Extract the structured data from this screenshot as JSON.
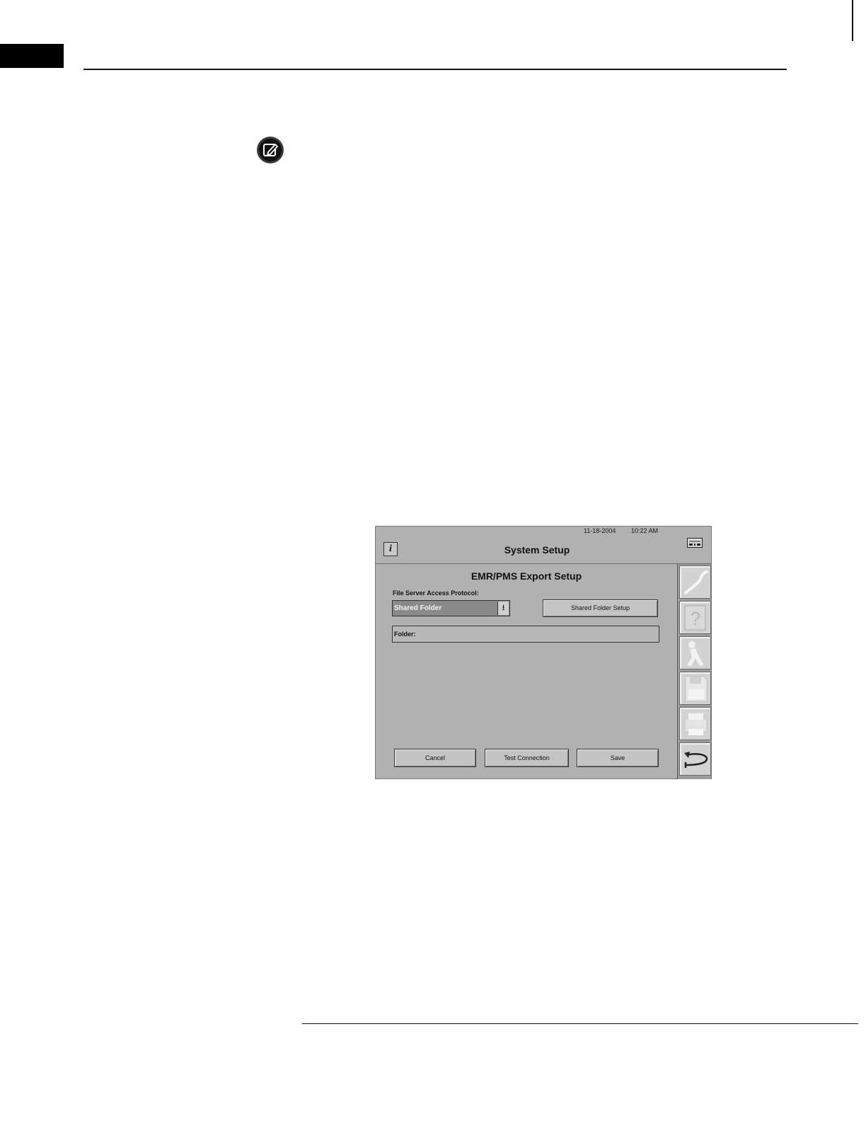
{
  "screen": {
    "date": "11-18-2004",
    "time": "10:22 AM",
    "info_icon": "i",
    "window_title": "System Setup",
    "panel_title": "EMR/PMS Export Setup",
    "protocol_label": "File Server Access Protocol:",
    "protocol_value": "Shared Folder",
    "dropdown_arrow": "⭳",
    "shared_folder_setup_label": "Shared Folder Setup",
    "folder_label": "Folder:",
    "cancel_label": "Cancel",
    "test_connection_label": "Test Connection",
    "save_label": "Save"
  },
  "icons": {
    "note": "note-edit-icon",
    "keyboard": "keyboard-icon",
    "sidebar": [
      "curve-icon",
      "help-icon",
      "person-icon",
      "floppy-disk-icon",
      "printer-icon",
      "return-arrow-icon"
    ]
  }
}
